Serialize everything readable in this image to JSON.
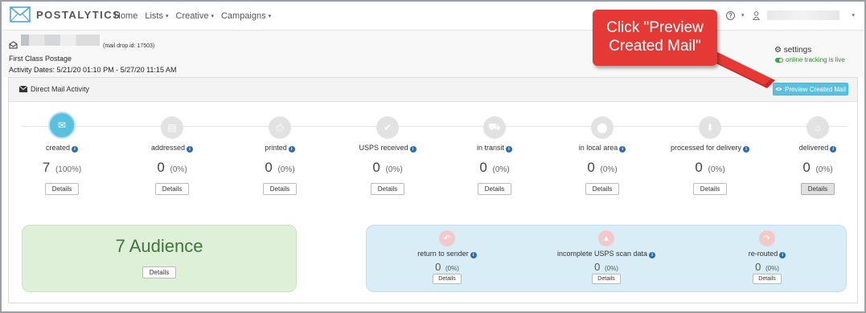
{
  "navbar": {
    "logo_text": "POSTALYTICS",
    "items": [
      {
        "label": "Home",
        "dropdown": false
      },
      {
        "label": "Lists",
        "dropdown": true
      },
      {
        "label": "Creative",
        "dropdown": true
      },
      {
        "label": "Campaigns",
        "dropdown": true
      }
    ],
    "help_glyph": "?",
    "caret_glyph": "▾"
  },
  "header": {
    "mail_drop_id": "(mail drop id: 17503)",
    "postage": "First Class Postage",
    "activity_dates": "Activity Dates: 5/21/20 01:10 PM - 5/27/20 11:15 AM",
    "settings_label": "settings",
    "tracking_status": "online tracking is live"
  },
  "panel": {
    "title": "Direct Mail Activity",
    "preview_button": "Preview Created Mail"
  },
  "steps": [
    {
      "label": "created",
      "count": "7",
      "percent": "(100%)",
      "icon": "envelope-icon",
      "active": true,
      "details": "Details"
    },
    {
      "label": "addressed",
      "count": "0",
      "percent": "(0%)",
      "icon": "address-card-icon",
      "active": false,
      "details": "Details"
    },
    {
      "label": "printed",
      "count": "0",
      "percent": "(0%)",
      "icon": "printer-icon",
      "active": false,
      "details": "Details"
    },
    {
      "label": "USPS received",
      "count": "0",
      "percent": "(0%)",
      "icon": "check-icon",
      "active": false,
      "details": "Details"
    },
    {
      "label": "in transit",
      "count": "0",
      "percent": "(0%)",
      "icon": "truck-icon",
      "active": false,
      "details": "Details"
    },
    {
      "label": "in local area",
      "count": "0",
      "percent": "(0%)",
      "icon": "map-marker-icon",
      "active": false,
      "details": "Details"
    },
    {
      "label": "processed for delivery",
      "count": "0",
      "percent": "(0%)",
      "icon": "stamp-icon",
      "active": false,
      "details": "Details"
    },
    {
      "label": "delivered",
      "count": "0",
      "percent": "(0%)",
      "icon": "home-icon",
      "active": false,
      "details": "Details"
    }
  ],
  "audience": {
    "title": "7 Audience",
    "details": "Details"
  },
  "exceptions": [
    {
      "label": "return to sender",
      "count": "0",
      "percent": "(0%)",
      "icon": "reply-icon",
      "details": "Details"
    },
    {
      "label": "incomplete USPS scan data",
      "count": "0",
      "percent": "(0%)",
      "icon": "warning-icon",
      "details": "Details"
    },
    {
      "label": "re-routed",
      "count": "0",
      "percent": "(0%)",
      "icon": "share-icon",
      "details": "Details"
    }
  ],
  "callout": {
    "line1": "Click \"Preview",
    "line2": "Created Mail\""
  },
  "colors": {
    "accent": "#5bc0de",
    "callout": "#e53935",
    "audience_bg": "#dff0d8",
    "exceptions_bg": "#d9edf7"
  }
}
